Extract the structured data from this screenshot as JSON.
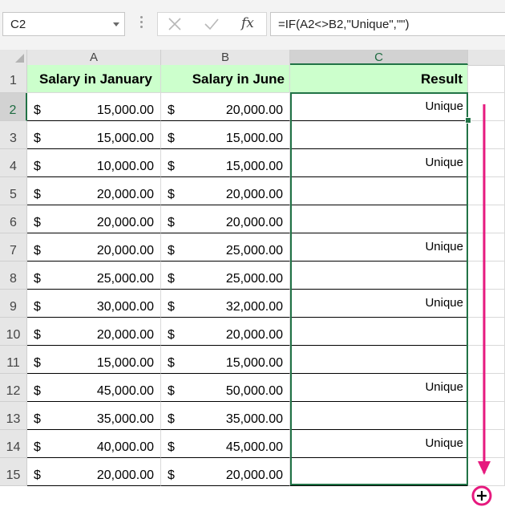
{
  "formula_bar": {
    "name_box": "C2",
    "formula": "=IF(A2<>B2,\"Unique\",\"\")",
    "fx_label": "fx"
  },
  "columns": [
    "A",
    "B",
    "C"
  ],
  "row_numbers": [
    "1",
    "2",
    "3",
    "4",
    "5",
    "6",
    "7",
    "8",
    "9",
    "10",
    "11",
    "12",
    "13",
    "14",
    "15"
  ],
  "headers": {
    "a": "Salary in January",
    "b": "Salary in June",
    "c": "Result"
  },
  "currency_symbol": "$",
  "rows": [
    {
      "a": "15,000.00",
      "b": "20,000.00",
      "c": "Unique"
    },
    {
      "a": "15,000.00",
      "b": "15,000.00",
      "c": ""
    },
    {
      "a": "10,000.00",
      "b": "15,000.00",
      "c": "Unique"
    },
    {
      "a": "20,000.00",
      "b": "20,000.00",
      "c": ""
    },
    {
      "a": "20,000.00",
      "b": "20,000.00",
      "c": ""
    },
    {
      "a": "20,000.00",
      "b": "25,000.00",
      "c": "Unique"
    },
    {
      "a": "25,000.00",
      "b": "25,000.00",
      "c": ""
    },
    {
      "a": "30,000.00",
      "b": "32,000.00",
      "c": "Unique"
    },
    {
      "a": "20,000.00",
      "b": "20,000.00",
      "c": ""
    },
    {
      "a": "15,000.00",
      "b": "15,000.00",
      "c": ""
    },
    {
      "a": "45,000.00",
      "b": "50,000.00",
      "c": "Unique"
    },
    {
      "a": "35,000.00",
      "b": "35,000.00",
      "c": ""
    },
    {
      "a": "40,000.00",
      "b": "45,000.00",
      "c": "Unique"
    },
    {
      "a": "20,000.00",
      "b": "20,000.00",
      "c": ""
    }
  ],
  "colors": {
    "header_fill": "#ccffcc",
    "selection": "#217346",
    "annotation_arrow": "#e6197e"
  }
}
